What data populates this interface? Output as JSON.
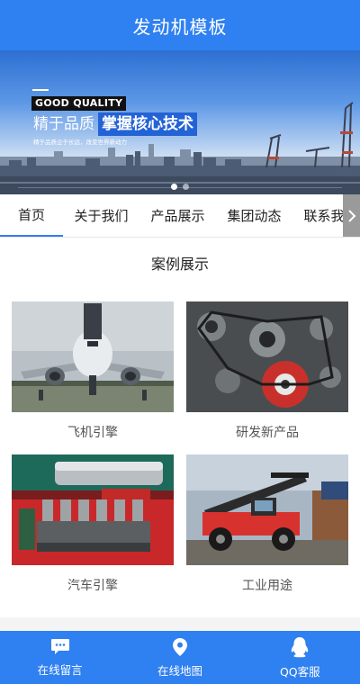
{
  "header": {
    "title": "发动机模板"
  },
  "banner": {
    "badge": "GOOD QUALITY",
    "headline_part1": "精于品质",
    "headline_part2": "掌握核心技术",
    "subtext": "精于品质企于长远，改变世界新动力",
    "slide_count": 2,
    "active_slide": 1
  },
  "nav": {
    "items": [
      {
        "label": "首页",
        "active": true
      },
      {
        "label": "关于我们",
        "active": false
      },
      {
        "label": "产品展示",
        "active": false
      },
      {
        "label": "集团动态",
        "active": false
      },
      {
        "label": "联系我们",
        "active": false
      }
    ]
  },
  "section": {
    "title": "案例展示"
  },
  "cases": [
    {
      "label": "飞机引擎",
      "image": "airplane-image"
    },
    {
      "label": "研发新产品",
      "image": "engine-belts-image"
    },
    {
      "label": "汽车引擎",
      "image": "car-engine-image"
    },
    {
      "label": "工业用途",
      "image": "industrial-machine-image"
    }
  ],
  "footer": {
    "items": [
      {
        "label": "在线留言",
        "icon": "chat-icon"
      },
      {
        "label": "在线地图",
        "icon": "map-pin-icon"
      },
      {
        "label": "QQ客服",
        "icon": "qq-penguin-icon"
      }
    ]
  },
  "colors": {
    "brand": "#2f80f0",
    "banner_highlight": "#2463d6"
  }
}
